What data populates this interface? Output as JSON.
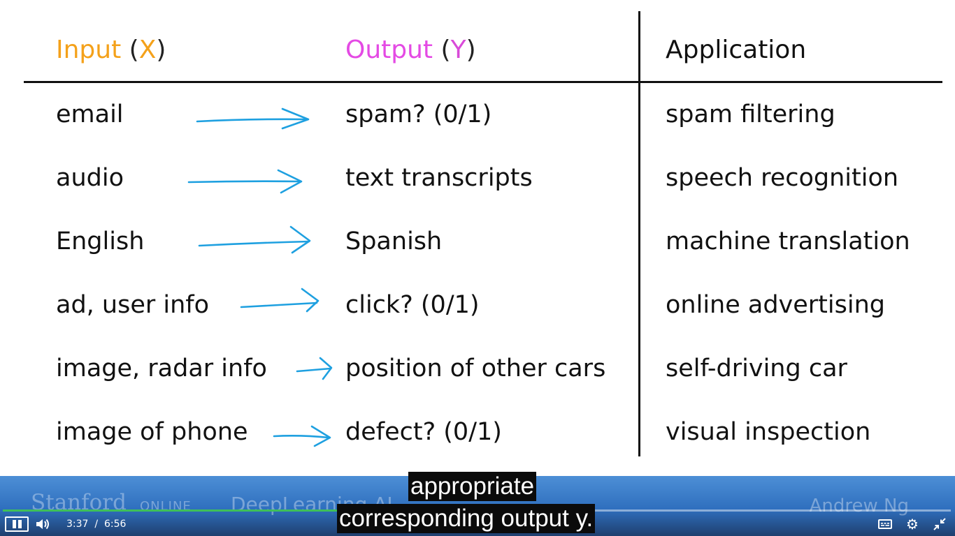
{
  "table": {
    "headers": {
      "input_word": "Input",
      "input_var": "X",
      "output_word": "Output",
      "output_var": "Y",
      "application": "Application"
    },
    "rows": [
      {
        "input": "email",
        "output": "spam? (0/1)",
        "application": "spam filtering"
      },
      {
        "input": "audio",
        "output": "text transcripts",
        "application": "speech recognition"
      },
      {
        "input": "English",
        "output": "Spanish",
        "application": "machine translation"
      },
      {
        "input": "ad, user info",
        "output": "click? (0/1)",
        "application": "online advertising"
      },
      {
        "input": "image, radar info",
        "output": "position of other cars",
        "application": "self-driving car"
      },
      {
        "input": "image of phone",
        "output": "defect? (0/1)",
        "application": "visual inspection"
      }
    ]
  },
  "colors": {
    "input_accent": "#f4a11a",
    "output_accent": "#e44ae4",
    "arrow": "#1ea0e0",
    "player_bar": "#2f6fbe",
    "progress": "#3fbf5a"
  },
  "player": {
    "branding": {
      "stanford": "Stanford",
      "online": "ONLINE",
      "deeplearning": "DeepLearning.AI",
      "instructor": "Andrew Ng"
    },
    "captions": [
      "appropriate",
      "corresponding output y."
    ],
    "current_time": "3:37",
    "time_separator": "/",
    "duration": "6:56",
    "progress": 0.521,
    "icons": {
      "pause": "pause-icon",
      "volume": "volume-icon",
      "captions": "closed-captions-icon",
      "settings": "gear-icon",
      "exit_fullscreen": "exit-fullscreen-icon"
    }
  }
}
